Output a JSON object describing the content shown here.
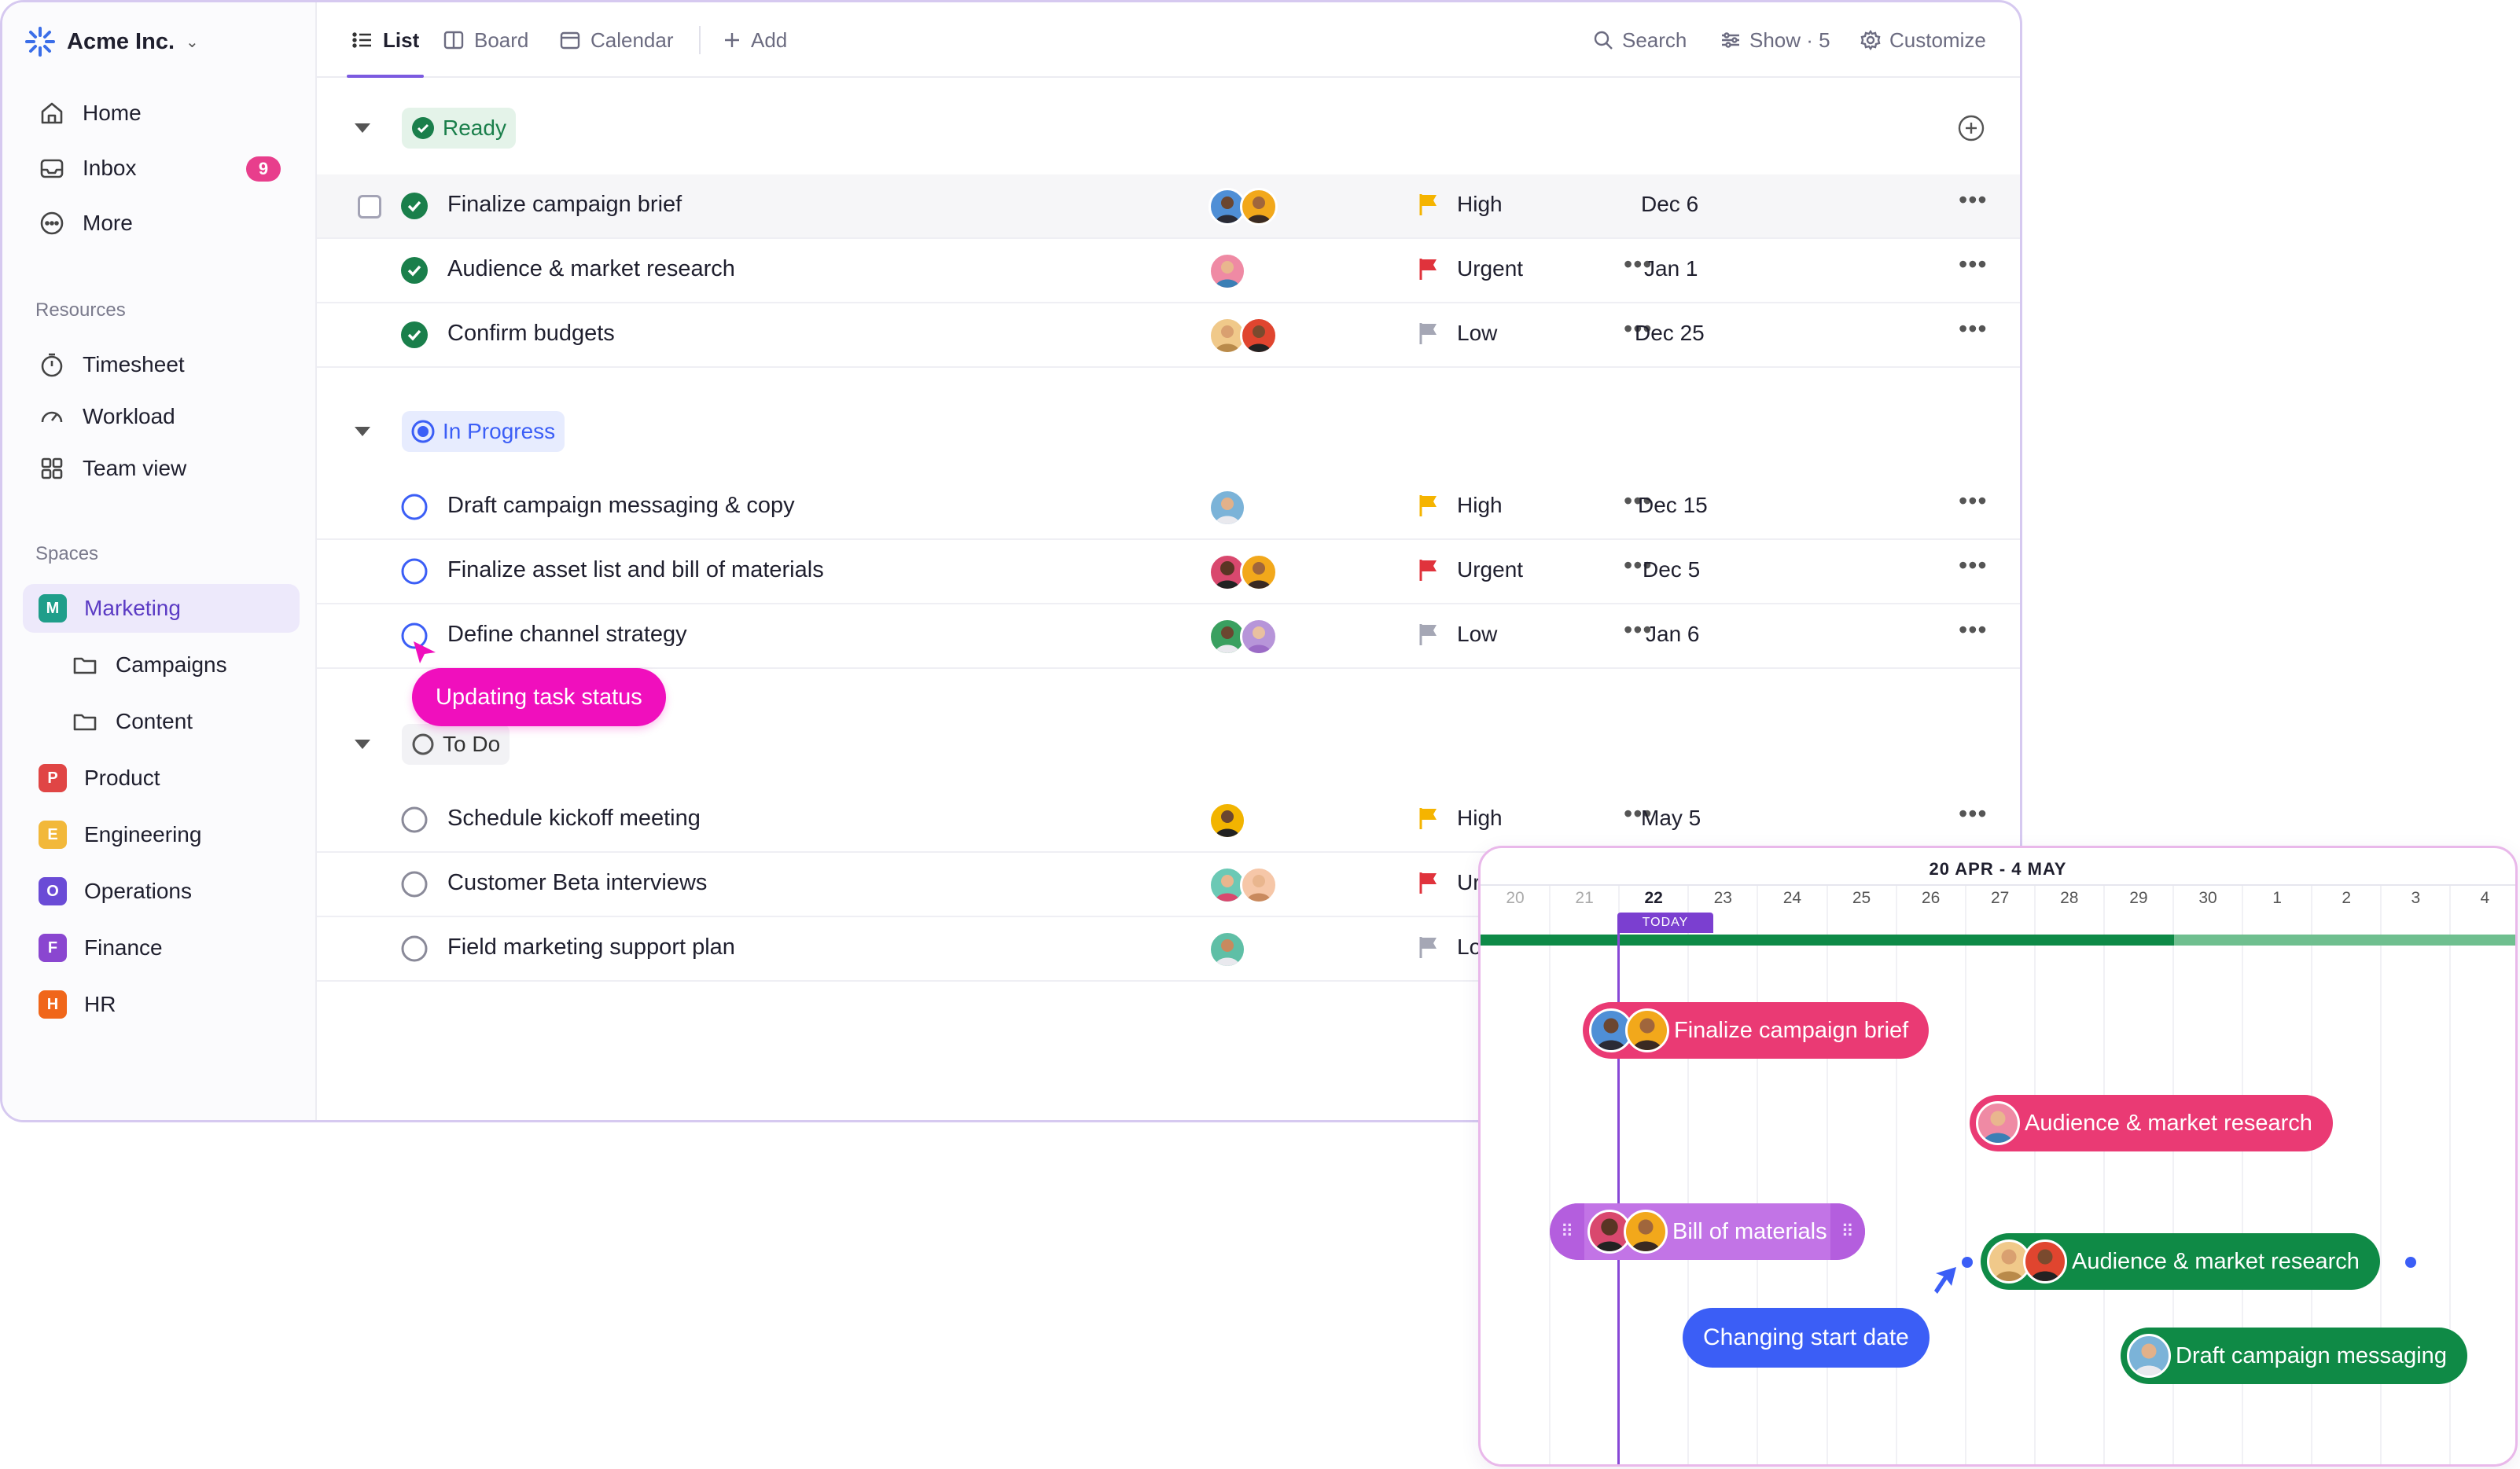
{
  "workspace": {
    "name": "Acme Inc."
  },
  "sidebar": {
    "nav": [
      {
        "label": "Home",
        "icon": "home-icon"
      },
      {
        "label": "Inbox",
        "icon": "inbox-icon",
        "badge": "9"
      },
      {
        "label": "More",
        "icon": "more-circle-icon"
      }
    ],
    "resources_label": "Resources",
    "resources": [
      {
        "label": "Timesheet",
        "icon": "timer-icon"
      },
      {
        "label": "Workload",
        "icon": "gauge-icon"
      },
      {
        "label": "Team view",
        "icon": "grid-icon"
      }
    ],
    "spaces_label": "Spaces",
    "spaces": [
      {
        "letter": "M",
        "label": "Marketing",
        "color": "#1f9e8a",
        "active": true
      },
      {
        "letter": "P",
        "label": "Product",
        "color": "#e04545"
      },
      {
        "letter": "E",
        "label": "Engineering",
        "color": "#f2b83a"
      },
      {
        "letter": "O",
        "label": "Operations",
        "color": "#6a4bd6"
      },
      {
        "letter": "F",
        "label": "Finance",
        "color": "#8a46d0"
      },
      {
        "letter": "H",
        "label": "HR",
        "color": "#f0661a"
      }
    ],
    "folders": [
      {
        "label": "Campaigns"
      },
      {
        "label": "Content"
      }
    ]
  },
  "toolbar": {
    "tabs": [
      {
        "label": "List",
        "active": true
      },
      {
        "label": "Board"
      },
      {
        "label": "Calendar"
      }
    ],
    "add_label": "Add",
    "search_label": "Search",
    "show_label": "Show · 5",
    "customize_label": "Customize"
  },
  "groups": [
    {
      "label": "Ready",
      "tasks": [
        {
          "name": "Finalize campaign brief",
          "priority": "High",
          "flag": "#f5b400",
          "date": "Dec 6",
          "done": true
        },
        {
          "name": "Audience & market research",
          "priority": "Urgent",
          "flag": "#e0333c",
          "date": "Jan 1",
          "done": true
        },
        {
          "name": "Confirm budgets",
          "priority": "Low",
          "flag": "#a5a7b5",
          "date": "Dec 25",
          "done": true
        }
      ]
    },
    {
      "label": "In Progress",
      "tasks": [
        {
          "name": "Draft campaign messaging & copy",
          "priority": "High",
          "flag": "#f5b400",
          "date": "Dec 15"
        },
        {
          "name": "Finalize asset list and bill of materials",
          "priority": "Urgent",
          "flag": "#e0333c",
          "date": "Dec 5"
        },
        {
          "name": "Define channel strategy",
          "priority": "Low",
          "flag": "#a5a7b5",
          "date": "Jan 6"
        }
      ]
    },
    {
      "label": "To Do",
      "tasks": [
        {
          "name": "Schedule kickoff meeting",
          "priority": "High",
          "flag": "#f5b400",
          "date": "May 5"
        },
        {
          "name": "Customer Beta interviews",
          "priority": "Ur",
          "flag": "#e0333c",
          "date": ""
        },
        {
          "name": "Field marketing support plan",
          "priority": "Lo",
          "flag": "#a5a7b5",
          "date": ""
        }
      ]
    }
  ],
  "tooltip_status": "Updating task status",
  "gantt": {
    "range": "20 APR - 4 MAY",
    "days": [
      "20",
      "21",
      "22",
      "23",
      "24",
      "25",
      "26",
      "27",
      "28",
      "29",
      "30",
      "1",
      "2",
      "3",
      "4"
    ],
    "today_label": "TODAY",
    "progress": 0.67,
    "bars": [
      {
        "label": "Finalize campaign brief"
      },
      {
        "label": "Audience & market research"
      },
      {
        "label": "Bill of materials"
      },
      {
        "label": "Audience & market research"
      },
      {
        "label": "Draft campaign messaging"
      }
    ],
    "tooltip": "Changing start date"
  },
  "colors": {
    "accent": "#7b5ae0",
    "ready": "#1a7f4b",
    "in_progress": "#3b5ef6",
    "pink_bar": "#ea3a74",
    "green_bar": "#0f8a46",
    "purple_bar": "#c274e6"
  }
}
